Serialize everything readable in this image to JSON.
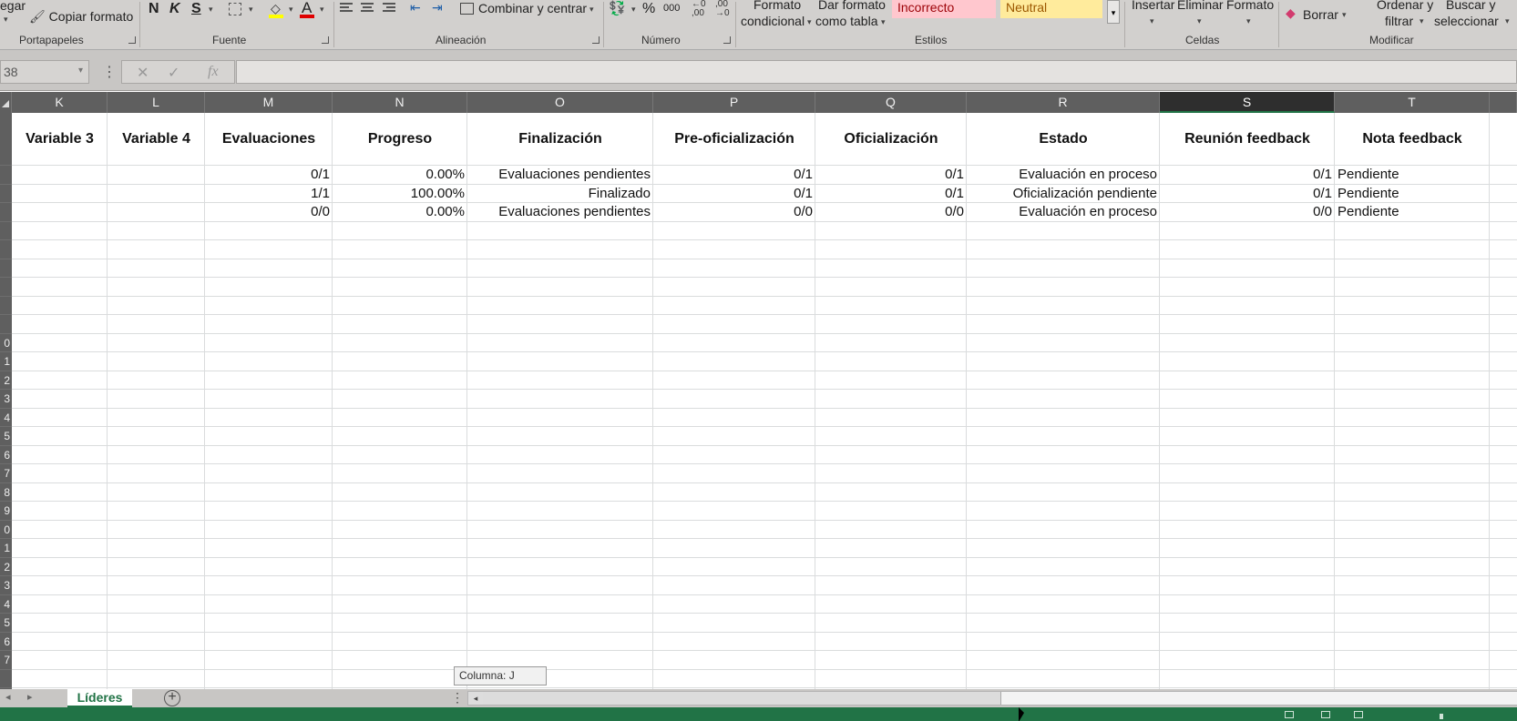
{
  "ribbon": {
    "clipboard": {
      "paste_label": "egar",
      "copy_format_label": "Copiar formato",
      "group_label": "Portapapeles"
    },
    "font": {
      "bold": "N",
      "italic": "K",
      "strike": "S",
      "group_label": "Fuente"
    },
    "alignment": {
      "merge_label": "Combinar y centrar",
      "group_label": "Alineación"
    },
    "number": {
      "percent": "%",
      "thousands": "000",
      "group_label": "Número"
    },
    "styles": {
      "conditional_format_line1": "Formato",
      "conditional_format_line2": "condicional",
      "table_format_line1": "Dar formato",
      "table_format_line2": "como tabla",
      "style_bad": "Incorrecto",
      "style_neutral": "Neutral",
      "group_label": "Estilos",
      "bad_bg": "#ffc7ce",
      "bad_fg": "#9c0006",
      "neutral_bg": "#ffeb9c",
      "neutral_fg": "#9c5700"
    },
    "cells": {
      "insert_label": "Insertar",
      "delete_label": "Eliminar",
      "format_label": "Formato",
      "group_label": "Celdas"
    },
    "editing": {
      "clear_label": "Borrar",
      "sort_line1": "Ordenar y",
      "sort_line2": "filtrar",
      "find_line1": "Buscar y",
      "find_line2": "seleccionar",
      "group_label": "Modificar"
    }
  },
  "formula_bar": {
    "name_box": "38",
    "cancel": "✕",
    "enter": "✓",
    "fx": "fx",
    "value": ""
  },
  "columns": [
    {
      "id": "K",
      "header": "Variable 3"
    },
    {
      "id": "L",
      "header": "Variable 4"
    },
    {
      "id": "M",
      "header": "Evaluaciones"
    },
    {
      "id": "N",
      "header": "Progreso"
    },
    {
      "id": "O",
      "header": "Finalización"
    },
    {
      "id": "P",
      "header": "Pre-oficialización"
    },
    {
      "id": "Q",
      "header": "Oficialización"
    },
    {
      "id": "R",
      "header": "Estado"
    },
    {
      "id": "S",
      "header": "Reunión feedback"
    },
    {
      "id": "T",
      "header": "Nota feedback"
    }
  ],
  "selected_column": "S",
  "rows": [
    {
      "M": "0/1",
      "N": "0.00%",
      "O": "Evaluaciones pendientes",
      "P": "0/1",
      "Q": "0/1",
      "R": "Evaluación en proceso",
      "S": "0/1",
      "T": "Pendiente"
    },
    {
      "M": "1/1",
      "N": "100.00%",
      "O": "Finalizado",
      "P": "0/1",
      "Q": "0/1",
      "R": "Oficialización pendiente",
      "S": "0/1",
      "T": "Pendiente"
    },
    {
      "M": "0/0",
      "N": "0.00%",
      "O": "Evaluaciones pendientes",
      "P": "0/0",
      "Q": "0/0",
      "R": "Evaluación en proceso",
      "S": "0/0",
      "T": "Pendiente"
    }
  ],
  "row_numbers": [
    "",
    "",
    "",
    "",
    "",
    "",
    "",
    "",
    "",
    "0",
    "1",
    "2",
    "3",
    "4",
    "5",
    "6",
    "7",
    "8",
    "9",
    "0",
    "1",
    "2",
    "3",
    "4",
    "5",
    "6",
    "7"
  ],
  "tooltip": "Columna: J",
  "sheet_tab": "Líderes",
  "add_sheet": "+",
  "colors": {
    "accent": "#217346",
    "header_bg": "#5f5f5f"
  }
}
